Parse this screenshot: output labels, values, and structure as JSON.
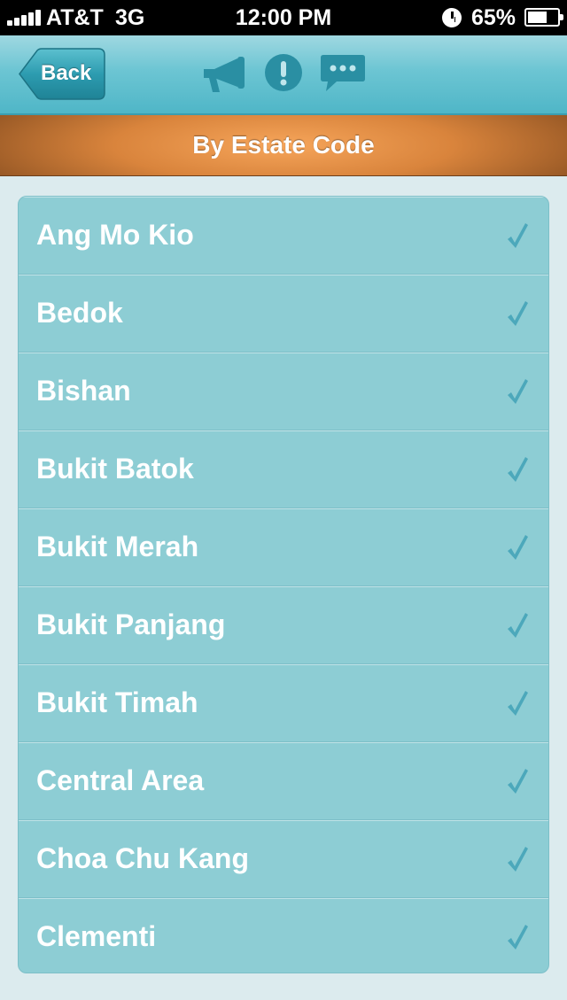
{
  "status_bar": {
    "carrier": "AT&T",
    "network": "3G",
    "time": "12:00 PM",
    "battery_percent": "65%",
    "battery_level": 0.65
  },
  "nav": {
    "back_label": "Back",
    "icons": [
      "megaphone-icon",
      "alert-icon",
      "chat-icon"
    ]
  },
  "header": {
    "title": "By Estate Code"
  },
  "estates": [
    {
      "label": "Ang Mo Kio",
      "checked": true
    },
    {
      "label": "Bedok",
      "checked": true
    },
    {
      "label": "Bishan",
      "checked": true
    },
    {
      "label": "Bukit Batok",
      "checked": true
    },
    {
      "label": "Bukit Merah",
      "checked": true
    },
    {
      "label": "Bukit Panjang",
      "checked": true
    },
    {
      "label": "Bukit Timah",
      "checked": true
    },
    {
      "label": "Central Area",
      "checked": true
    },
    {
      "label": "Choa Chu Kang",
      "checked": true
    },
    {
      "label": "Clementi",
      "checked": true
    }
  ],
  "colors": {
    "nav_teal": "#6cc5d3",
    "header_orange": "#f6a55a",
    "list_bg": "#8dcdd4",
    "check": "#4ca8bb"
  }
}
